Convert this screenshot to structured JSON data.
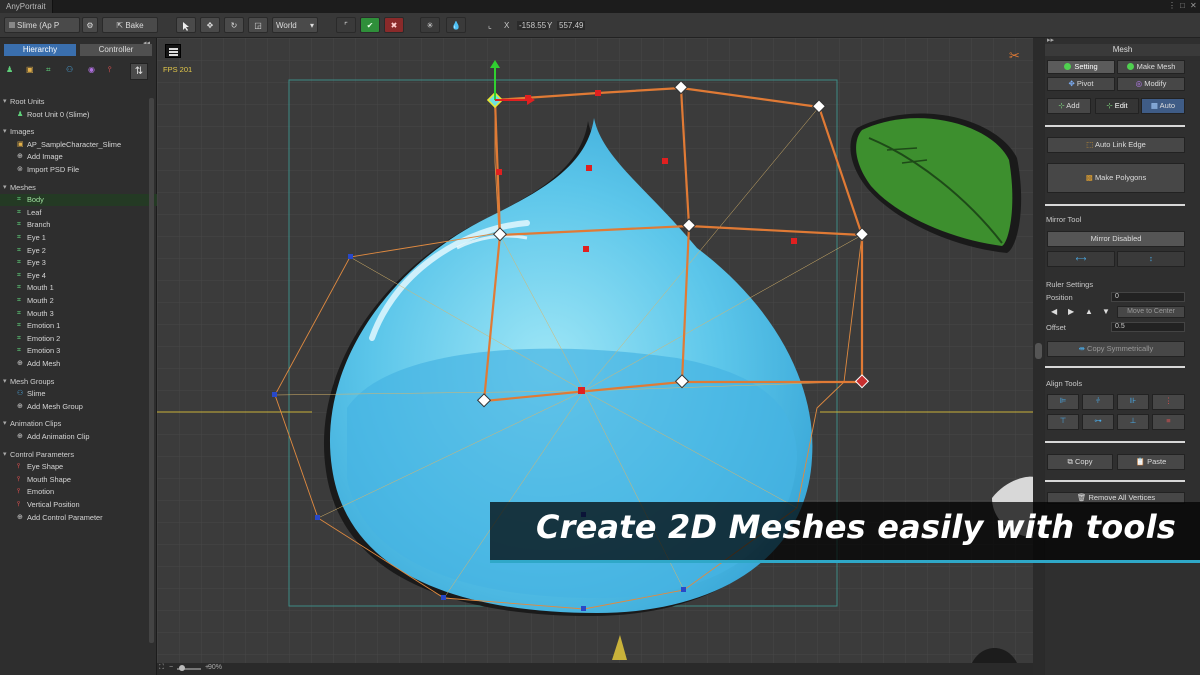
{
  "window": {
    "title": "AnyPortrait"
  },
  "toolbar": {
    "document": "Slime (Ap P",
    "bake_label": "Bake",
    "space_select": "World",
    "coord_x_label": "X",
    "coord_x_value": "-158.55",
    "coord_y_label": "Y",
    "coord_y_value": "557.49"
  },
  "left_panel": {
    "tabs": [
      "Hierarchy",
      "Controller"
    ],
    "icons": [
      "root-unit",
      "image",
      "mesh",
      "mesh-group",
      "animation",
      "control-parameter"
    ],
    "sections": [
      {
        "label": "Root Units",
        "items": [
          {
            "label": "Root Unit 0 (Slime)",
            "icon": "root-unit"
          }
        ]
      },
      {
        "label": "Images",
        "items": [
          {
            "label": "AP_SampleCharacter_Slime",
            "icon": "image"
          },
          {
            "label": "Add Image",
            "icon": "add"
          },
          {
            "label": "Import PSD File",
            "icon": "import"
          }
        ]
      },
      {
        "label": "Meshes",
        "items": [
          {
            "label": "Body",
            "icon": "mesh",
            "selected": true
          },
          {
            "label": "Leaf",
            "icon": "mesh"
          },
          {
            "label": "Branch",
            "icon": "mesh"
          },
          {
            "label": "Eye 1",
            "icon": "mesh"
          },
          {
            "label": "Eye 2",
            "icon": "mesh"
          },
          {
            "label": "Eye 3",
            "icon": "mesh"
          },
          {
            "label": "Eye 4",
            "icon": "mesh"
          },
          {
            "label": "Mouth 1",
            "icon": "mesh"
          },
          {
            "label": "Mouth 2",
            "icon": "mesh"
          },
          {
            "label": "Mouth 3",
            "icon": "mesh"
          },
          {
            "label": "Emotion 1",
            "icon": "mesh"
          },
          {
            "label": "Emotion 2",
            "icon": "mesh"
          },
          {
            "label": "Emotion 3",
            "icon": "mesh"
          },
          {
            "label": "Add Mesh",
            "icon": "add"
          }
        ]
      },
      {
        "label": "Mesh Groups",
        "items": [
          {
            "label": "Slime",
            "icon": "mesh-group"
          },
          {
            "label": "Add Mesh Group",
            "icon": "add"
          }
        ]
      },
      {
        "label": "Animation Clips",
        "items": [
          {
            "label": "Add Animation Clip",
            "icon": "add"
          }
        ]
      },
      {
        "label": "Control Parameters",
        "items": [
          {
            "label": "Eye Shape",
            "icon": "param"
          },
          {
            "label": "Mouth Shape",
            "icon": "param"
          },
          {
            "label": "Emotion",
            "icon": "param"
          },
          {
            "label": "Vertical Position",
            "icon": "param"
          },
          {
            "label": "Add Control Parameter",
            "icon": "add"
          }
        ]
      }
    ]
  },
  "canvas": {
    "fps": "FPS 201",
    "zoom": "90%"
  },
  "right_panel": {
    "title": "Mesh",
    "setting": "Setting",
    "make_mesh": "Make Mesh",
    "pivot": "Pivot",
    "modify": "Modify",
    "add": "Add",
    "edit": "Edit",
    "auto": "Auto",
    "auto_link_edge": "Auto Link Edge",
    "make_polygons": "Make Polygons",
    "mirror_tool": "Mirror Tool",
    "mirror_disabled": "Mirror Disabled",
    "ruler_settings": "Ruler Settings",
    "position_label": "Position",
    "position_value": "0",
    "move_to_center": "Move to Center",
    "offset_label": "Offset",
    "offset_value": "0.5",
    "copy_symmetrically": "Copy Symmetrically",
    "align_tools": "Align Tools",
    "copy": "Copy",
    "paste": "Paste",
    "remove_all_vertices": "Remove All Vertices"
  },
  "banner": {
    "text": "Create 2D Meshes easily with tools"
  },
  "colors": {
    "accent": "#3a6fae",
    "mesh_edge": "#e07a35",
    "selection": "#2f8f3a",
    "banner_line": "#2fa8c8"
  }
}
